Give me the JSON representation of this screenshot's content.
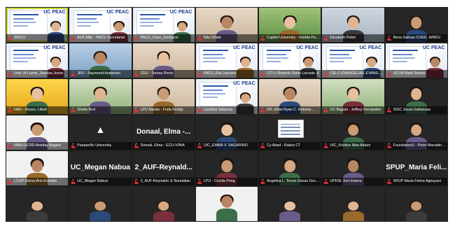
{
  "participants": [
    {
      "name": "WVCU",
      "bg": "slide",
      "active": true
    },
    {
      "name": "AUF Alfie - PACU Secretariat",
      "bg": "slide"
    },
    {
      "name": "PACU_Clare_Gerbacio",
      "bg": "slide"
    },
    {
      "name": "Nila Oñate",
      "bg": "warm"
    },
    {
      "name": "Capitol University - Imelda Pagtulo...",
      "bg": "green"
    },
    {
      "name": "Elizabeth Pellet",
      "bg": "office"
    },
    {
      "name": "Bena Salinas COED, WMSU",
      "bg": "dark"
    },
    {
      "name": "Univ. of Luzon_Jeaniza Joson",
      "bg": "slide"
    },
    {
      "name": "JRU - Raymond Andaman",
      "bg": "blue"
    },
    {
      "name": "CEU - Teresa Perez",
      "bg": "warm"
    },
    {
      "name": "PACU_Rai Lescano",
      "bg": "slide"
    },
    {
      "name": "CIT-U Roberto Sison Lacoste Jr",
      "bg": "slide"
    },
    {
      "name": "CIE-O EVANGELINE EVANGELI...",
      "bg": "slide"
    },
    {
      "name": "UCLM Mark Santos",
      "bg": "slide"
    },
    {
      "name": "HAU - Reyes, Lilliah",
      "bg": "yellow"
    },
    {
      "name": "Sheila Brol",
      "bg": "plant"
    },
    {
      "name": "LPU Manila - Frida Festijo",
      "bg": "warm"
    },
    {
      "name": "Caroline Valencia",
      "bg": "slide"
    },
    {
      "name": "DR. Ethel Ryan C. Roberts...",
      "bg": "warm"
    },
    {
      "name": "UC Baguio - Jeffrey Fernandez",
      "bg": "plant"
    },
    {
      "name": "SISC Josue Gallanosa",
      "bg": "dark"
    },
    {
      "name": "NWU-UCRD Areiday Bagani",
      "bg": "light"
    },
    {
      "name": "Panpacific University",
      "bg": "dark",
      "glyph": true
    },
    {
      "name": "Donaal, Elma - ECU-VPAA",
      "bg": "dark",
      "big": "Donaal, Elma -..."
    },
    {
      "name": "UIC_EMMA V. SAGARINO",
      "bg": "dark"
    },
    {
      "name": "Cy Abad - Rakso CT",
      "bg": "dark",
      "card": true
    },
    {
      "name": "UIC_Kristine Mae Adaon",
      "bg": "dark"
    },
    {
      "name": "FoundationU - Peter Macabingkil",
      "bg": "dark"
    },
    {
      "name": "LCUP Divina Ann Eusebio",
      "bg": "light"
    },
    {
      "name": "UC_Megan Nabua",
      "bg": "dark",
      "big": "UC_Megan Nabua"
    },
    {
      "name": "2_AUF-Reynaldo Jr Bundalian",
      "bg": "dark",
      "big": "2_AUF-Reynald..."
    },
    {
      "name": "LPU - Cecilia Pring",
      "bg": "dark"
    },
    {
      "name": "Angelica L. Torres Davao Docto...",
      "bg": "dark"
    },
    {
      "name": "UPHSL Ken Estera",
      "bg": "dark"
    },
    {
      "name": "SPUP Maria Felina Agbayani",
      "bg": "dark",
      "big": "SPUP_Maria Feli..."
    },
    {
      "name": "",
      "bg": "dark"
    },
    {
      "name": "",
      "bg": "dark"
    },
    {
      "name": "",
      "bg": "dark"
    },
    {
      "name": "",
      "bg": "light"
    },
    {
      "name": "",
      "bg": "dark"
    },
    {
      "name": "",
      "bg": "dark"
    },
    {
      "name": "",
      "bg": "dark"
    }
  ],
  "slide_logo": "UC PEAC"
}
